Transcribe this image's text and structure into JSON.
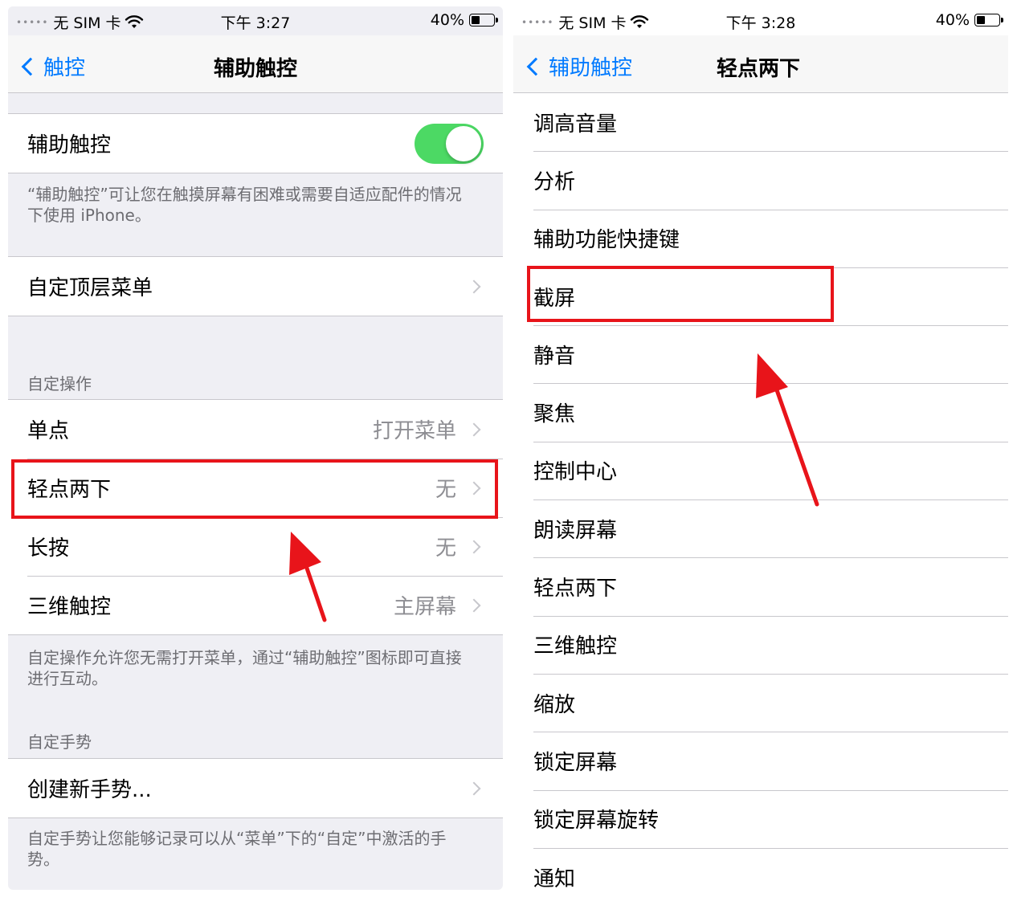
{
  "left": {
    "status": {
      "carrier": "无 SIM 卡",
      "time": "下午 3:27",
      "battery": "40%"
    },
    "nav": {
      "back_label": "触控",
      "title": "辅助触控"
    },
    "toggle_row": {
      "label": "辅助触控",
      "on": true
    },
    "toggle_footer": "“辅助触控”可让您在触摸屏幕有困难或需要自适应配件的情况下使用 iPhone。",
    "custom_top_menu": "自定顶层菜单",
    "custom_actions_header": "自定操作",
    "actions": [
      {
        "label": "单点",
        "value": "打开菜单"
      },
      {
        "label": "轻点两下",
        "value": "无"
      },
      {
        "label": "长按",
        "value": "无"
      },
      {
        "label": "三维触控",
        "value": "主屏幕"
      }
    ],
    "actions_footer": "自定操作允许您无需打开菜单，通过“辅助触控”图标即可直接进行互动。",
    "gestures_header": "自定手势",
    "create_gesture": "创建新手势...",
    "gestures_footer": "自定手势让您能够记录可以从“菜单”下的“自定”中激活的手势。"
  },
  "right": {
    "status": {
      "carrier": "无 SIM 卡",
      "time": "下午 3:28",
      "battery": "40%"
    },
    "nav": {
      "back_label": "辅助触控",
      "title": "轻点两下"
    },
    "items": [
      "调高音量",
      "分析",
      "辅助功能快捷键",
      "截屏",
      "静音",
      "聚焦",
      "控制中心",
      "朗读屏幕",
      "轻点两下",
      "三维触控",
      "缩放",
      "锁定屏幕",
      "锁定屏幕旋转",
      "通知"
    ]
  },
  "colors": {
    "accent": "#007aff",
    "toggle_on": "#4cd964",
    "highlight": "#e8141a"
  },
  "icons": [
    "back-chevron-icon",
    "wifi-icon",
    "battery-icon",
    "disclosure-chevron-icon",
    "red-arrow-annotation"
  ]
}
